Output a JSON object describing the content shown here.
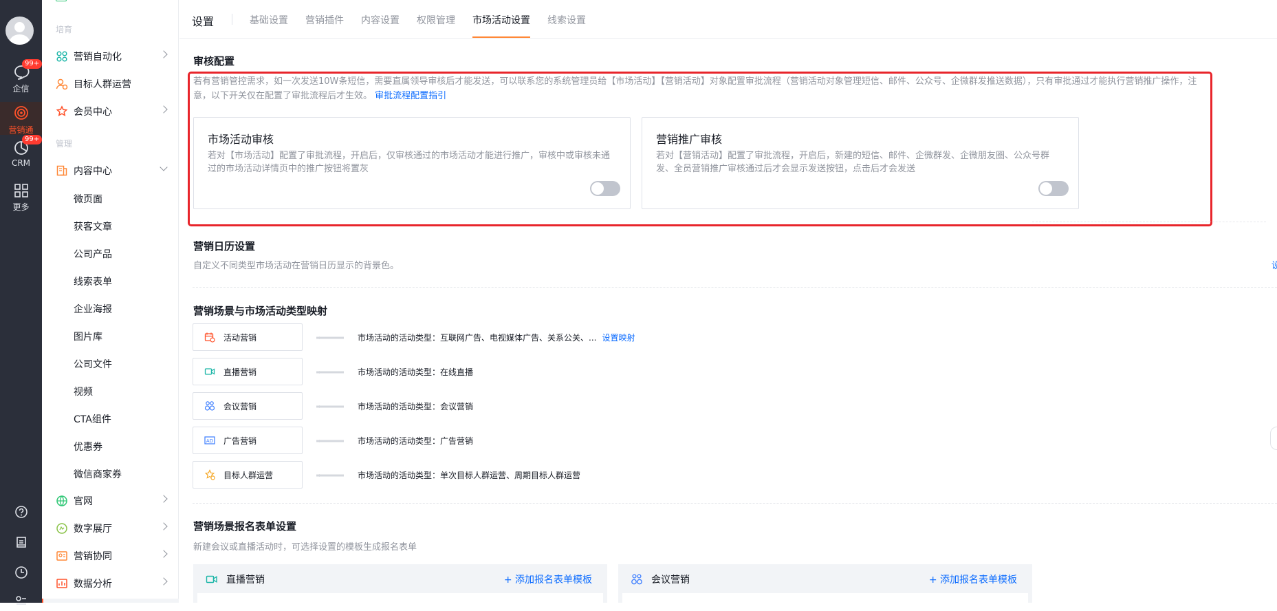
{
  "rail": {
    "items": [
      {
        "label": "企信",
        "badge": "99+"
      },
      {
        "label": "营销通",
        "badge": ""
      },
      {
        "label": "CRM",
        "badge": "99+"
      },
      {
        "label": "更多",
        "badge": ""
      }
    ]
  },
  "menu": {
    "group1": "培育",
    "group2": "管理",
    "items_top": [
      {
        "label": "营销自动化"
      },
      {
        "label": "目标人群运营"
      },
      {
        "label": "会员中心"
      }
    ],
    "content_center": "内容中心",
    "sub_items": [
      "微页面",
      "获客文章",
      "公司产品",
      "线索表单",
      "企业海报",
      "图片库",
      "公司文件",
      "视频",
      "CTA组件",
      "优惠券",
      "微信商家券"
    ],
    "items_bottom": [
      {
        "label": "官网"
      },
      {
        "label": "数字展厅"
      },
      {
        "label": "营销协同"
      },
      {
        "label": "数据分析"
      }
    ]
  },
  "header": {
    "title": "设置",
    "tabs": [
      "基础设置",
      "营销插件",
      "内容设置",
      "权限管理",
      "市场活动设置",
      "线索设置"
    ],
    "active_tab": "市场活动设置"
  },
  "audit": {
    "title": "审核配置",
    "desc": "若有营销管控需求，如一次发送10W条短信，需要直属领导审核后才能发送，可以联系您的系统管理员给【市场活动】【营销活动】对象配置审批流程（营销活动对象管理短信、邮件、公众号、企微群发推送数据），只有审批通过才能执行营销推广操作，注意，以下开关仅在配置了审批流程后才生效。",
    "link": "审批流程配置指引",
    "cards": [
      {
        "title": "市场活动审核",
        "desc": "若对【市场活动】配置了审批流程，开启后，仅审核通过的市场活动才能进行推广，审核中或审核未通过的市场活动详情页中的推广按钮将置灰",
        "enabled": false
      },
      {
        "title": "营销推广审核",
        "desc": "若对【营销活动】配置了审批流程，开启后，新建的短信、邮件、企微群发、企微朋友圈、公众号群发、全员营销推广审核通过后才会显示发送按钮，点击后才会发送",
        "enabled": false
      }
    ]
  },
  "calendar": {
    "title": "营销日历设置",
    "desc": "自定义不同类型市场活动在营销日历显示的背景色。",
    "right_link": "设"
  },
  "mapping": {
    "title": "营销场景与市场活动类型映射",
    "prefix": "市场活动的活动类型：",
    "rows": [
      {
        "name": "活动营销",
        "icon": "calendar-icon",
        "types": "市场活动的活动类型：互联网广告、电视媒体广告、关系公关、...",
        "link": "设置映射"
      },
      {
        "name": "直播营销",
        "icon": "video-icon",
        "types": "市场活动的活动类型：在线直播",
        "link": ""
      },
      {
        "name": "会议营销",
        "icon": "meeting-icon",
        "types": "市场活动的活动类型：会议营销",
        "link": ""
      },
      {
        "name": "广告营销",
        "icon": "ad-icon",
        "types": "市场活动的活动类型：广告营销",
        "link": ""
      },
      {
        "name": "目标人群运营",
        "icon": "target-group-icon",
        "types": "市场活动的活动类型：单次目标人群运营、周期目标人群运营",
        "link": ""
      }
    ]
  },
  "signup": {
    "title": "营销场景报名表单设置",
    "desc": "新建会议或直播活动时，可选择设置的模板生成报名表单",
    "panels": [
      {
        "name": "直播营销",
        "add": "添加报名表单模板"
      },
      {
        "name": "会议营销",
        "add": "添加报名表单模板"
      }
    ]
  },
  "colors": {
    "accent": "#ff8837",
    "link": "#0c6cff",
    "highlight_border": "#e8252b",
    "rail_bg": "#2b2f3a",
    "rail_active": "#ff522a"
  }
}
